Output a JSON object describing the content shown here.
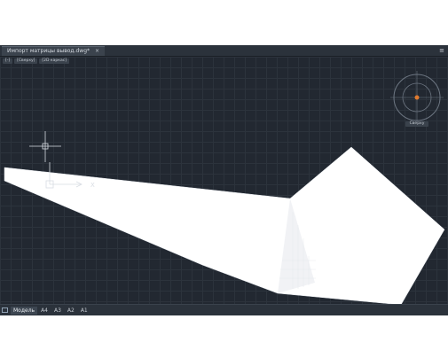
{
  "document_tab": {
    "title": "Импорт матрицы вывод.dwg*",
    "close_glyph": "×"
  },
  "menu_glyph": "≡",
  "view_controls": [
    "[-]",
    "[Сверху]",
    "[2D каркас]"
  ],
  "compass": {
    "label": "Сверху"
  },
  "ucs": {
    "x_label": "X",
    "y_label": "Y"
  },
  "layout_tabs": [
    {
      "label": "Модель",
      "active": true
    },
    {
      "label": "A4"
    },
    {
      "label": "A3"
    },
    {
      "label": "A2"
    },
    {
      "label": "A1"
    }
  ],
  "colors": {
    "canvas_background": "#222831",
    "grid": "#2c333c",
    "shape_fill": "#ffffff",
    "compass_center": "#e07a2e"
  },
  "icons": [
    "ucs-icon",
    "crosshair-cursor-icon",
    "viewcube-compass-icon",
    "layout-icon"
  ]
}
